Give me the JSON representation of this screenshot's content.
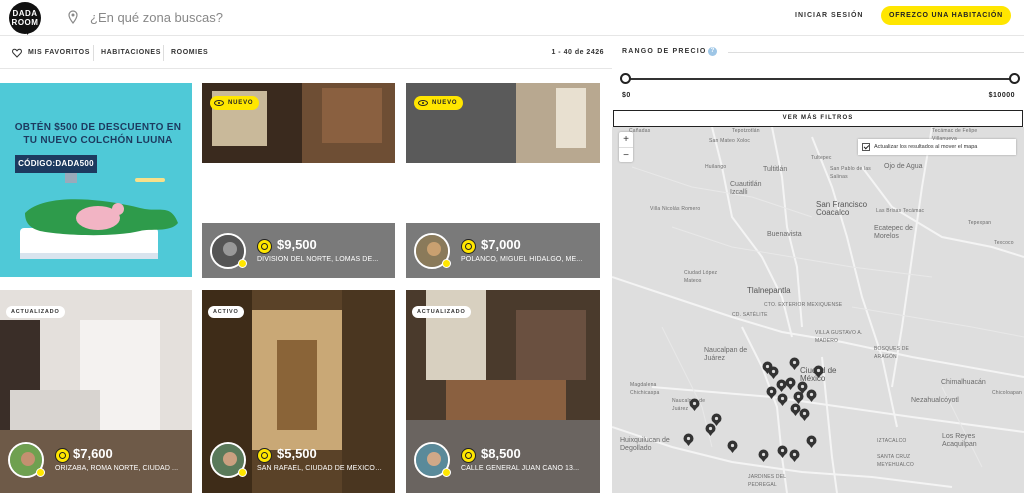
{
  "brand": {
    "logo_text": "DADA ROOM"
  },
  "header": {
    "search_placeholder": "¿En qué zona buscas?",
    "login_label": "INICIAR SESIÓN",
    "offer_label": "OFREZCO UNA HABITACIÓN",
    "accent_color": "#ffe600"
  },
  "subnav": {
    "favorites": "MIS FAVORITOS",
    "rooms": "HABITACIONES",
    "roomies": "ROOMIES",
    "results_count": "1 - 40 de 2426"
  },
  "filters": {
    "price_label": "RANGO DE PRECIO",
    "help": "?",
    "price_min": "$0",
    "price_max": "$10000",
    "more_filters": "VER MÁS FILTROS"
  },
  "map": {
    "zoom_in": "+",
    "zoom_out": "−",
    "update_checkbox_label": "Actualizar los resultados al mover el mapa",
    "labels": {
      "canadas": "Cañadas",
      "tepotzotlan": "Tepotzotlán",
      "san_mateo_xoloc": "San Mateo Xoloc",
      "tecamac": "Tecámac de Felipe Villanueva",
      "ojo_de_agua": "Ojo de Agua",
      "tultepec": "Tultepec",
      "huilango": "Huilango",
      "tultitlan": "Tultitlán",
      "san_pablo_salinas": "San Pablo de las Salinas",
      "cuautitlan": "Cuautitlán Izcalli",
      "villa_nicolas_romero": "Villa Nicolás Romero",
      "san_francisco_coacalco": "San Francisco Coacalco",
      "las_brisas_tecamac": "Las Brisas Tecámac",
      "tepexpan": "Tepexpan",
      "buenavista": "Buenavista",
      "ecatepec": "Ecatepec de Morelos",
      "texcoco": "Texcoco",
      "ciudad_lopez_mateos": "Ciudad López Mateos",
      "tlalnepantla": "Tlalnepantla",
      "circuito_exterior": "CTO. EXTERIOR MEXIQUENSE",
      "cd_satelite": "CD. SATÉLITE",
      "villa_gustavo": "VILLA GUSTAVO A. MADERO",
      "bosques_aragon": "BOSQUES DE ARAGÓN",
      "naucalpan": "Naucalpan de Juárez",
      "ciudad_mexico": "Ciudad de México",
      "chimalhuacan": "Chimalhuacán",
      "madgalena_chichicaspa": "Magdalena Chichicaspa",
      "naucalpan_juarez": "Naucalpan de Juárez",
      "nezahualcoyotl": "Nezahualcóyotl",
      "chicoloapan": "Chicoloapan",
      "huixquilucan": "Huixquilucan de Degollado",
      "iztacalco": "IZTACALCO",
      "los_reyes": "Los Reyes Acaquilpan",
      "santa_cruz": "SANTA CRUZ MEYEHUALCO",
      "jardines": "JARDINES DEL PEDREGAL"
    }
  },
  "promo": {
    "title": "OBTÉN $500 DE DESCUENTO EN TU NUEVO COLCHÓN LUUNA",
    "code": "CÓDIGO:DADA500"
  },
  "listings": [
    {
      "badge": "NUEVO",
      "price": "$9,500",
      "address": "DIVISIÓN DEL NORTE, LOMAS DE..."
    },
    {
      "badge": "NUEVO",
      "price": "$7,000",
      "address": "POLANCO, MIGUEL HIDALGO, MÉ..."
    },
    {
      "badge": "ACTUALIZADO",
      "price": "$7,600",
      "address": "ORIZABA, ROMA NORTE, CIUDAD ..."
    },
    {
      "badge": "ACTIVO",
      "price": "$5,500",
      "address": "SAN RAFAEL, CIUDAD DE MÉXICO, ..."
    },
    {
      "badge": "ACTUALIZADO",
      "price": "$8,500",
      "address": "CALLE GENERAL JUAN CANO 13..."
    }
  ]
}
